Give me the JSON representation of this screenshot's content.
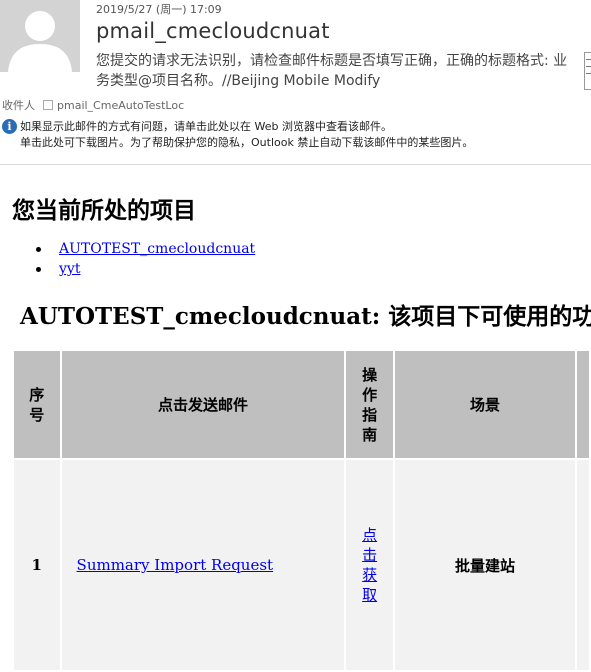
{
  "message": {
    "date": "2019/5/27 (周一) 17:09",
    "sender": "pmail_cmecloudcnuat",
    "subject": "您提交的请求无法识别，请检查邮件标题是否填写正确，正确的标题格式: 业务类型@项目名称。//Beijing Mobile Modify",
    "recipients_label": "收件人",
    "recipient": "pmail_CmeAutoTestLoc",
    "notice_line1": "如果显示此邮件的方式有问题，请单击此处以在 Web 浏览器中查看该邮件。",
    "notice_line2": "单击此处可下载图片。为了帮助保护您的隐私，Outlook 禁止自动下载该邮件中的某些图片。",
    "icons": [
      "avatar-icon",
      "info-icon"
    ]
  },
  "body": {
    "current_heading": "您当前所处的项目",
    "projects": [
      "AUTOTEST_cmecloudcnuat",
      "yyt"
    ],
    "project_heading": "AUTOTEST_cmecloudcnuat: 该项目下可使用的功能",
    "table": {
      "headers": [
        "序号",
        "点击发送邮件",
        "操作指南",
        "场景",
        ""
      ],
      "rows": [
        {
          "index": "1",
          "mail_link": "Summary Import Request",
          "guide_link": "点击获取",
          "scenario": "批量建站"
        }
      ]
    }
  }
}
